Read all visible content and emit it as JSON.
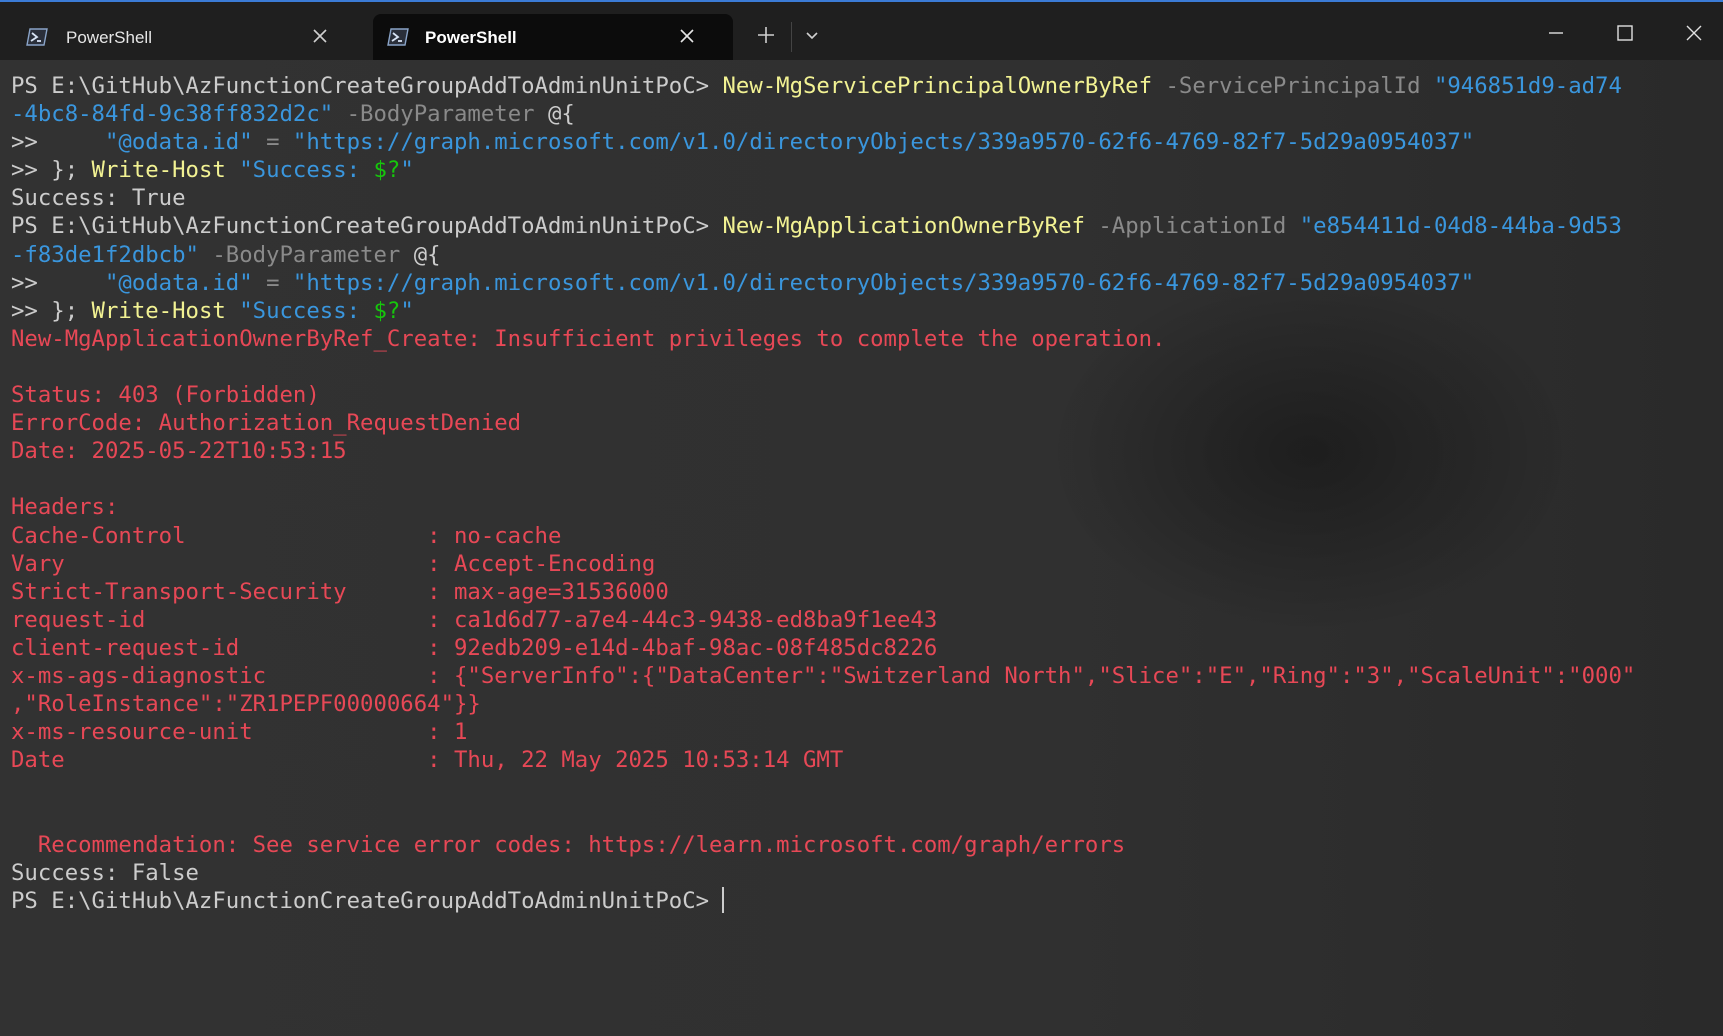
{
  "tabs": [
    {
      "label": "PowerShell",
      "active": false
    },
    {
      "label": "PowerShell",
      "active": true
    }
  ],
  "icons": {
    "tab_icon": "powershell-icon",
    "close": "close-icon",
    "new_tab": "plus-icon",
    "dropdown": "chevron-down-icon",
    "minimize": "minimize-icon",
    "maximize": "maximize-icon",
    "window_close": "close-icon"
  },
  "colors": {
    "command": "#f2f293",
    "parameter": "#8a8a8a",
    "string": "#3a96dd",
    "variable": "#16c60c",
    "error": "#e74856",
    "text": "#cccccc",
    "accent": "#3b7bd6"
  },
  "terminal": {
    "prompt1": "PS E:\\GitHub\\AzFunctionCreateGroupAddToAdminUnitPoC> ",
    "cmd1": "New-MgServicePrincipalOwnerByRef",
    "param1": " -ServicePrincipalId ",
    "id1a": "\"946851d9-ad74",
    "id1b": "-4bc8-84fd-9c38ff832d2c\"",
    "bodyparam1": " -BodyParameter ",
    "open1": "@{",
    "cont1": ">>     ",
    "odata_key1": "\"@odata.id\"",
    "eq1": " = ",
    "odata_val1": "\"https://graph.microsoft.com/v1.0/directoryObjects/339a9570-62f6-4769-82f7-5d29a0954037\"",
    "cont2": ">> }; ",
    "writehost1": "Write-Host",
    "space1": " ",
    "success_str1a": "\"Success: ",
    "success_var1": "$?",
    "success_str1b": "\"",
    "result1": "Success: True",
    "prompt2": "PS E:\\GitHub\\AzFunctionCreateGroupAddToAdminUnitPoC> ",
    "cmd2": "New-MgApplicationOwnerByRef",
    "param2": " -ApplicationId ",
    "id2a": "\"e854411d-04d8-44ba-9d53",
    "id2b": "-f83de1f2dbcb\"",
    "bodyparam2": " -BodyParameter ",
    "open2": "@{",
    "cont3": ">>     ",
    "odata_key2": "\"@odata.id\"",
    "eq2": " = ",
    "odata_val2": "\"https://graph.microsoft.com/v1.0/directoryObjects/339a9570-62f6-4769-82f7-5d29a0954037\"",
    "cont4": ">> }; ",
    "writehost2": "Write-Host",
    "space2": " ",
    "success_str2a": "\"Success: ",
    "success_var2": "$?",
    "success_str2b": "\"",
    "error_line": "New-MgApplicationOwnerByRef_Create: Insufficient privileges to complete the operation.",
    "status": "Status: 403 (Forbidden)",
    "errorcode": "ErrorCode: Authorization_RequestDenied",
    "date": "Date: 2025-05-22T10:53:15",
    "headers": "Headers:",
    "h_cache": "Cache-Control                  : no-cache",
    "h_vary": "Vary                           : Accept-Encoding",
    "h_sts": "Strict-Transport-Security      : max-age=31536000",
    "h_reqid": "request-id                     : ca1d6d77-a7e4-44c3-9438-ed8ba9f1ee43",
    "h_clientreqid": "client-request-id              : 92edb209-e14d-4baf-98ac-08f485dc8226",
    "h_diag_a": "x-ms-ags-diagnostic            : {\"ServerInfo\":{\"DataCenter\":\"Switzerland North\",\"Slice\":\"E\",\"Ring\":\"3\",\"ScaleUnit\":\"000\"",
    "h_diag_b": ",\"RoleInstance\":\"ZR1PEPF00000664\"}}",
    "h_resunit": "x-ms-resource-unit             : 1",
    "h_date": "Date                           : Thu, 22 May 2025 10:53:14 GMT",
    "recommendation": "  Recommendation: See service error codes: https://learn.microsoft.com/graph/errors",
    "result2": "Success: False",
    "prompt3": "PS E:\\GitHub\\AzFunctionCreateGroupAddToAdminUnitPoC> "
  }
}
